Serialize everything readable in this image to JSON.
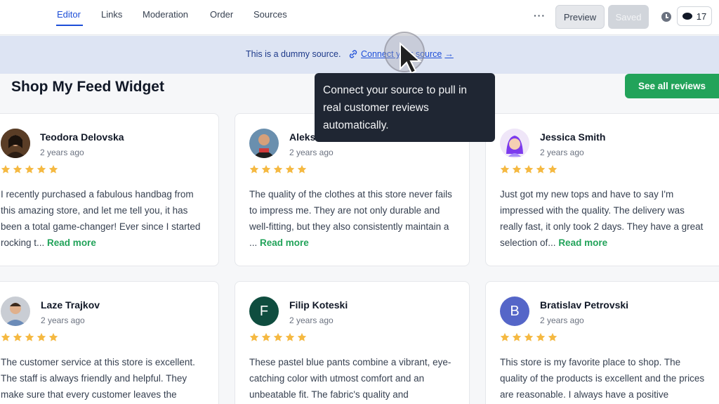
{
  "nav": {
    "tabs": [
      {
        "label": "Editor"
      },
      {
        "label": "Links"
      },
      {
        "label": "Moderation"
      },
      {
        "label": "Order"
      },
      {
        "label": "Sources"
      }
    ],
    "more_label": "···",
    "preview_label": "Preview",
    "saved_label": "Saved",
    "counter_value": "17"
  },
  "banner": {
    "text": "This is a dummy source.",
    "link_label": "Connect your source"
  },
  "tooltip": {
    "text": "Connect your source to pull in real customer reviews automatically."
  },
  "widget": {
    "title": "Shop My Feed Widget",
    "see_all_label": "See all reviews",
    "read_more_label": "Read more"
  },
  "reviews": [
    {
      "name": "Teodora Delovska",
      "date": "2 years ago",
      "rating": 5,
      "text": "I recently purchased a fabulous handbag from this amazing store, and let me tell you, it has been a total game-changer! Ever since I started rocking t..."
    },
    {
      "name": "Aleks",
      "date": "2 years ago",
      "rating": 5,
      "text": "The quality of the clothes at this store never fails to impress me. They are not only durable and well-fitting, but they also consistently maintain a ..."
    },
    {
      "name": "Jessica Smith",
      "date": "2 years ago",
      "rating": 5,
      "text": "Just got my new tops and have to say I'm impressed with the quality. The delivery was really fast, it only took 2 days. They have a great selection of..."
    },
    {
      "name": "Laze Trajkov",
      "date": "2 years ago",
      "rating": 5,
      "text": "The customer service at this store is excellent. The staff is always friendly and helpful. They make sure that every customer leaves the"
    },
    {
      "name": "Filip Koteski",
      "date": "2 years ago",
      "rating": 5,
      "initial": "F",
      "text": "These pastel blue pants combine a vibrant, eye-catching color with utmost comfort and an unbeatable fit. The fabric's quality and"
    },
    {
      "name": "Bratislav Petrovski",
      "date": "2 years ago",
      "rating": 5,
      "initial": "B",
      "text": "This store is my favorite place to shop. The quality of the products is excellent and the prices are reasonable. I always have a positive"
    }
  ],
  "colors": {
    "accent": "#1d4ed8",
    "green": "#22a35a",
    "star": "#f5b942",
    "avatar_f": "#0f4d3f",
    "avatar_b": "#5566c8"
  }
}
